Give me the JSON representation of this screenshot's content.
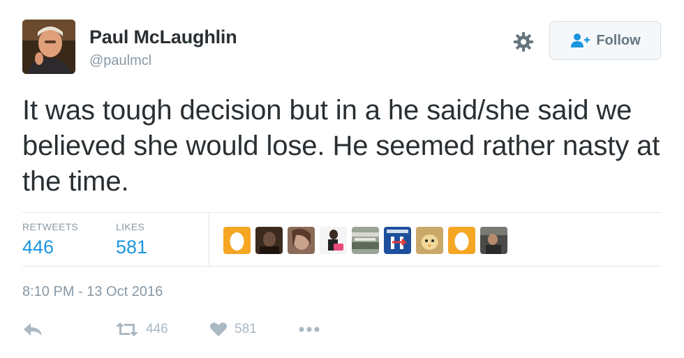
{
  "user": {
    "name": "Paul McLaughlin",
    "handle": "@paulmcl"
  },
  "follow_button": {
    "label": "Follow",
    "icon": "add-user-icon"
  },
  "settings_icon": "gear-icon",
  "tweet": {
    "text": "It was tough decision but in a he said/she said we believed she would lose. He seemed rather nasty at the time."
  },
  "stats": {
    "retweets_label": "RETWEETS",
    "retweets": "446",
    "likes_label": "LIKES",
    "likes": "581"
  },
  "likers": [
    {
      "kind": "egg",
      "color": "#f5a623"
    },
    {
      "kind": "photo",
      "color": "#3b2a1e"
    },
    {
      "kind": "photo",
      "color": "#8a6a58"
    },
    {
      "kind": "photo",
      "color": "#f4f4f4"
    },
    {
      "kind": "photo",
      "color": "#7a8a78"
    },
    {
      "kind": "logo",
      "color": "#1d4f9c"
    },
    {
      "kind": "photo",
      "color": "#c9a86a"
    },
    {
      "kind": "egg",
      "color": "#f5a623"
    },
    {
      "kind": "photo",
      "color": "#4a4a48"
    }
  ],
  "timestamp": "8:10 PM - 13 Oct 2016",
  "actions": {
    "reply_icon": "reply-icon",
    "retweet_icon": "retweet-icon",
    "retweet_count": "446",
    "like_icon": "heart-icon",
    "like_count": "581",
    "more_icon": "more-icon"
  },
  "colors": {
    "link": "#1b95e0",
    "muted": "#8899a6",
    "action": "#aab8c2",
    "text": "#292f33"
  }
}
